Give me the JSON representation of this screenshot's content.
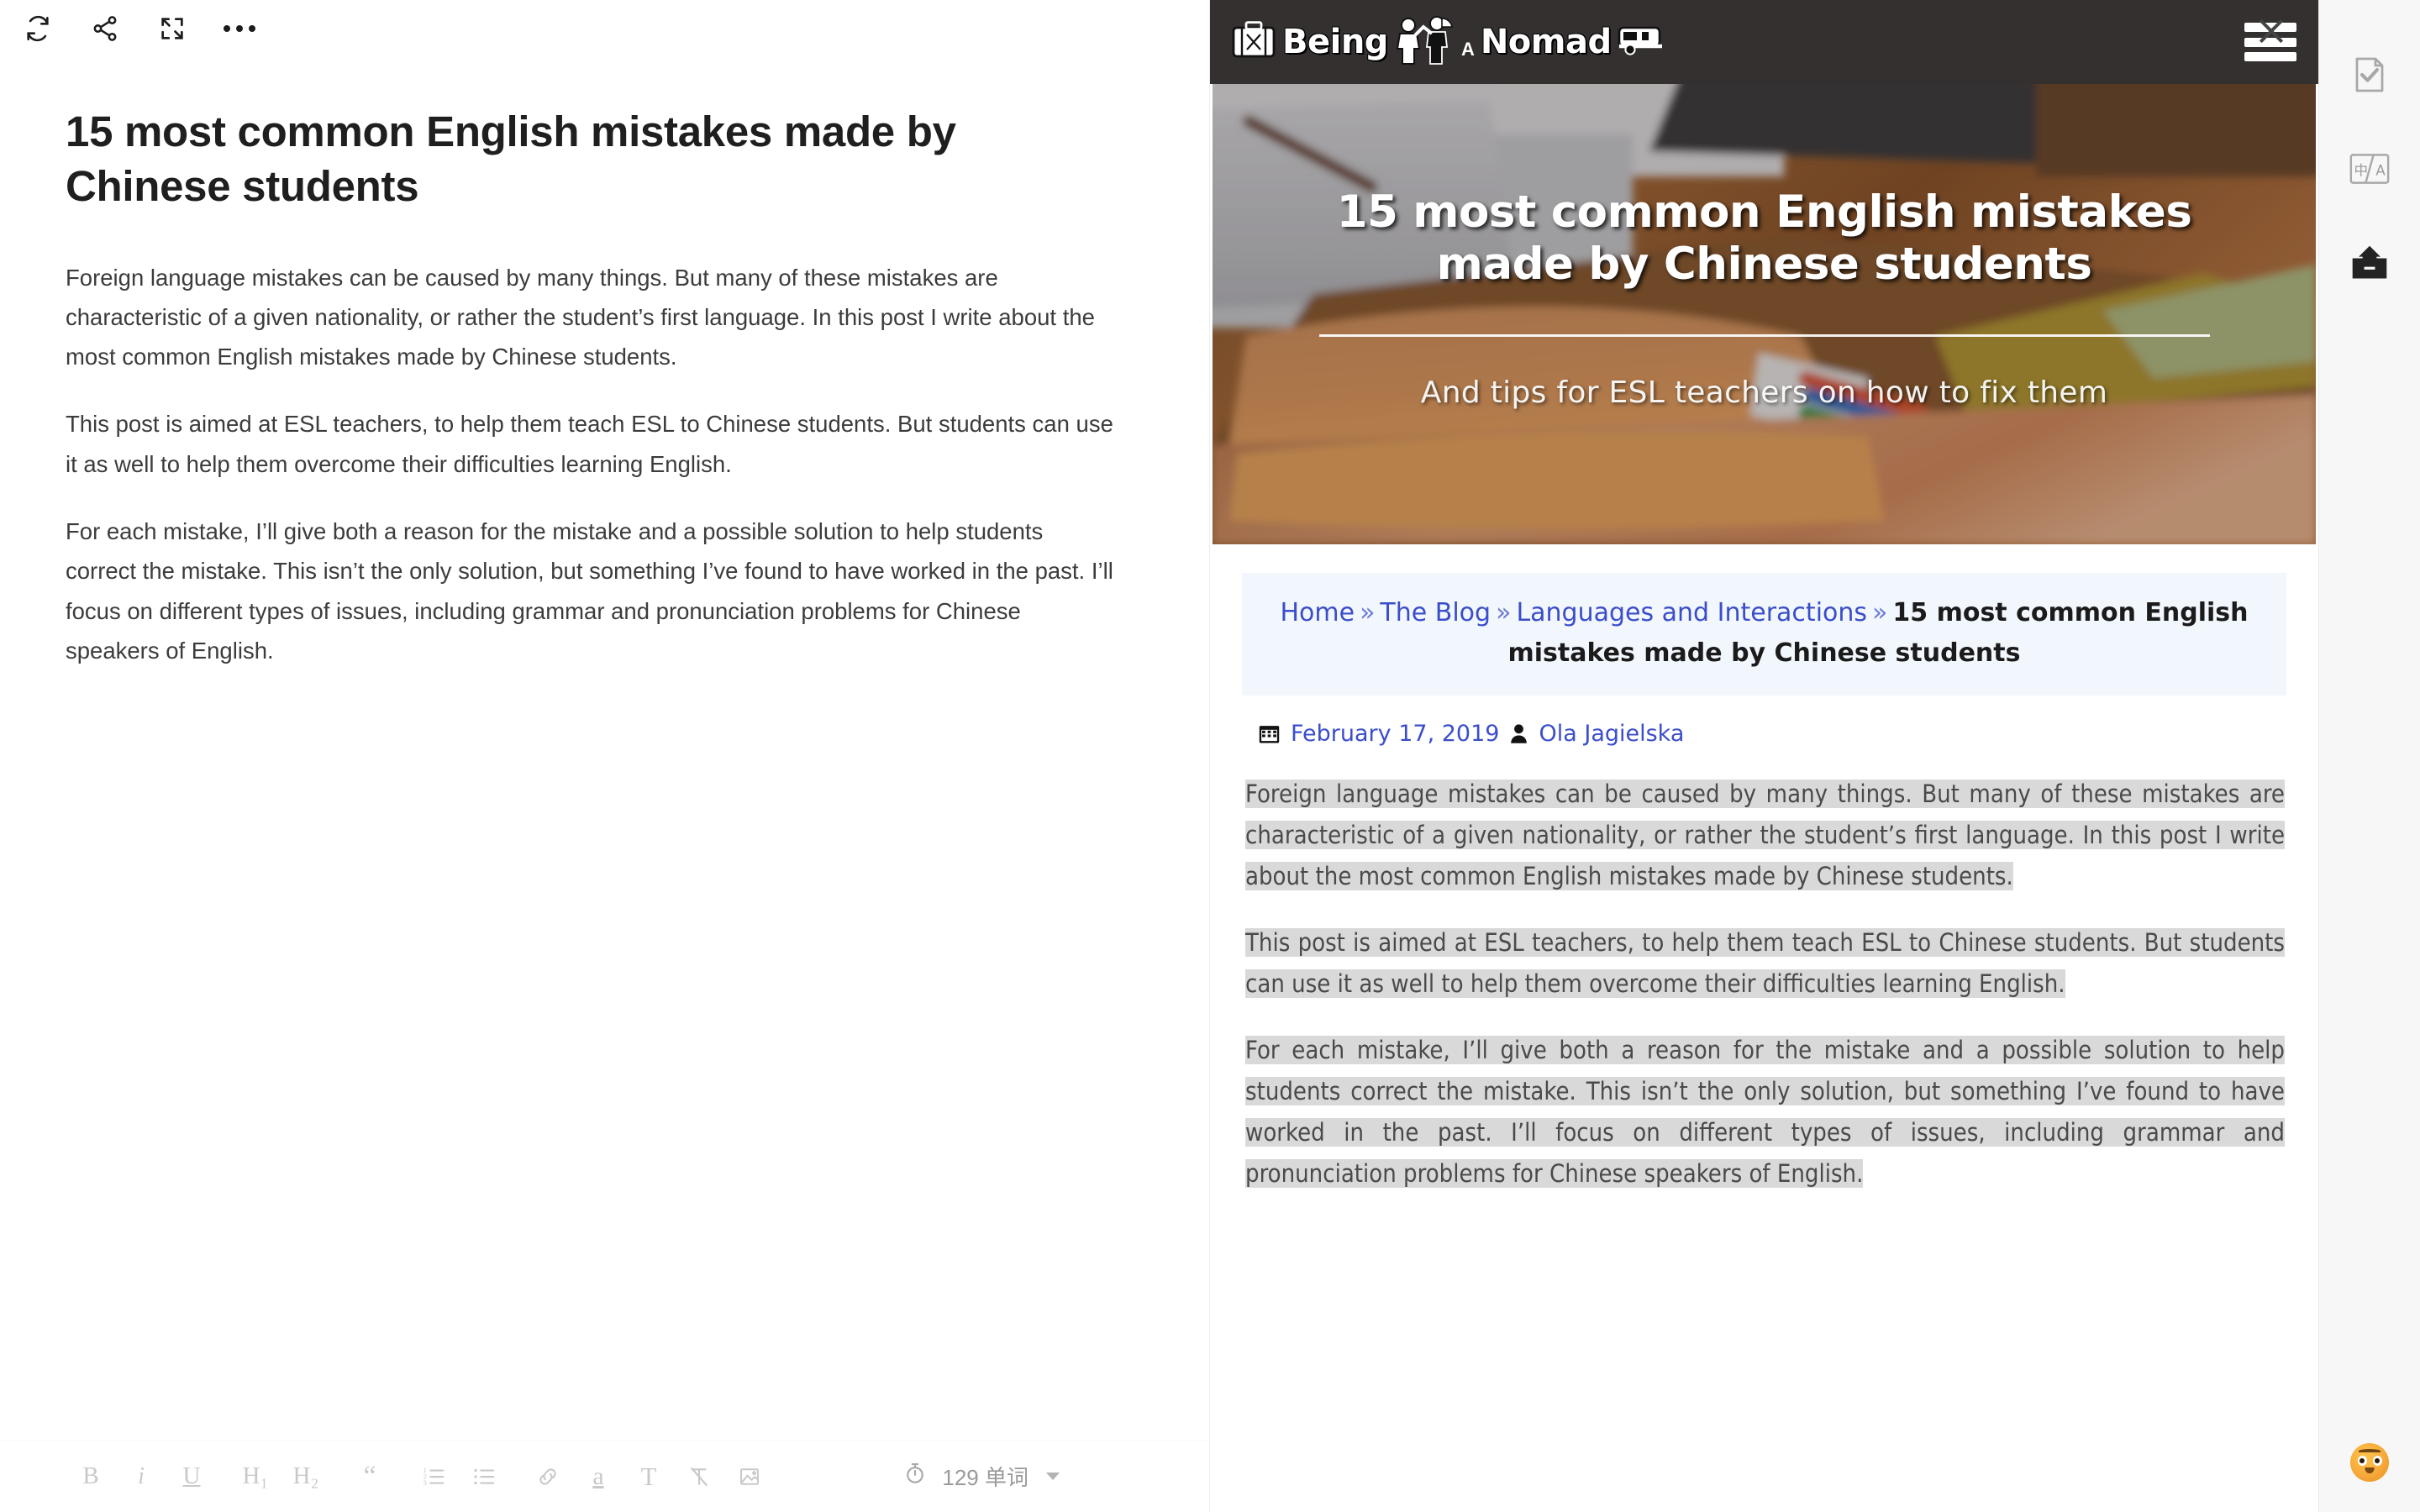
{
  "editor": {
    "toolbar": {
      "refresh_label": "refresh",
      "share_label": "share",
      "fullscreen_label": "fullscreen",
      "more_label": "more"
    },
    "title": "15 most common English mistakes made by Chinese students",
    "paragraphs": [
      "Foreign language mistakes can be caused by many things. But many of these mistakes are characteristic of a given nationality, or rather the student’s first language. In this post I write about the most common English mistakes made by Chinese students.",
      "This post is aimed at ESL teachers, to help them teach ESL to Chinese students. But students can use it as well to help them overcome their difficulties learning English.",
      "For each mistake, I’ll give both a reason for the mistake and a possible solution to help students correct the mistake. This isn’t the only solution, but something I’ve found to have worked in the past. I’ll focus on different types of issues, including grammar and pronunciation problems for Chinese speakers of English."
    ],
    "format_bar": {
      "bold": "B",
      "italic": "i",
      "underline": "U",
      "heading1": "H₁",
      "heading2": "H₂",
      "quote": "“",
      "ordered_list": "ordered-list",
      "bullet_list": "bullet-list",
      "link": "link",
      "highlight": "a",
      "text_color": "T",
      "clear_format": "clear-format",
      "image": "image"
    },
    "word_count": "129 单词"
  },
  "web": {
    "site_logo": {
      "word1": "Being",
      "word2": "A",
      "word3": "Nomad"
    },
    "hero": {
      "title": "15 most common English mistakes made by Chinese students",
      "subtitle": "And tips for ESL teachers on how to fix them"
    },
    "breadcrumb": {
      "items": [
        {
          "label": "Home",
          "link": true
        },
        {
          "label": "The Blog",
          "link": true
        },
        {
          "label": "Languages and Interactions",
          "link": true
        }
      ],
      "separator": "»",
      "current": "15 most common English mistakes made by Chinese students"
    },
    "meta": {
      "date": "February 17, 2019",
      "author": "Ola Jagielska"
    },
    "paragraphs": [
      "Foreign language mistakes can be caused by many things. But many of these mistakes are characteristic of a given nationality, or rather the student’s first language. In this post I write about the most common English mistakes made by Chinese students.",
      "This post is aimed at ESL teachers, to help them teach ESL to Chinese students. But students can use it as well to help them overcome their difficulties learning English.",
      "For each mistake, I’ll give both a reason for the mistake and a possible solution to help students correct the mistake. This isn’t the only solution, but something I’ve found to have worked in the past. I’ll focus on different types of issues, including grammar and pronunciation problems for Chinese speakers of English."
    ]
  },
  "right_sidebar": {
    "items": [
      {
        "icon": "clip-note-check-icon",
        "label": "clip"
      },
      {
        "icon": "translate-icon",
        "label": "中/A"
      },
      {
        "icon": "inbox-icon",
        "label": "inbox"
      }
    ],
    "avatar": "emoji-avatar"
  },
  "colors": {
    "link": "#3b4ec9",
    "selection": "#d9d9d9",
    "breadcrumb_bg": "#f2f6fd",
    "header_bg": "#33302f",
    "sidebar_bg": "#f7f7f7"
  }
}
